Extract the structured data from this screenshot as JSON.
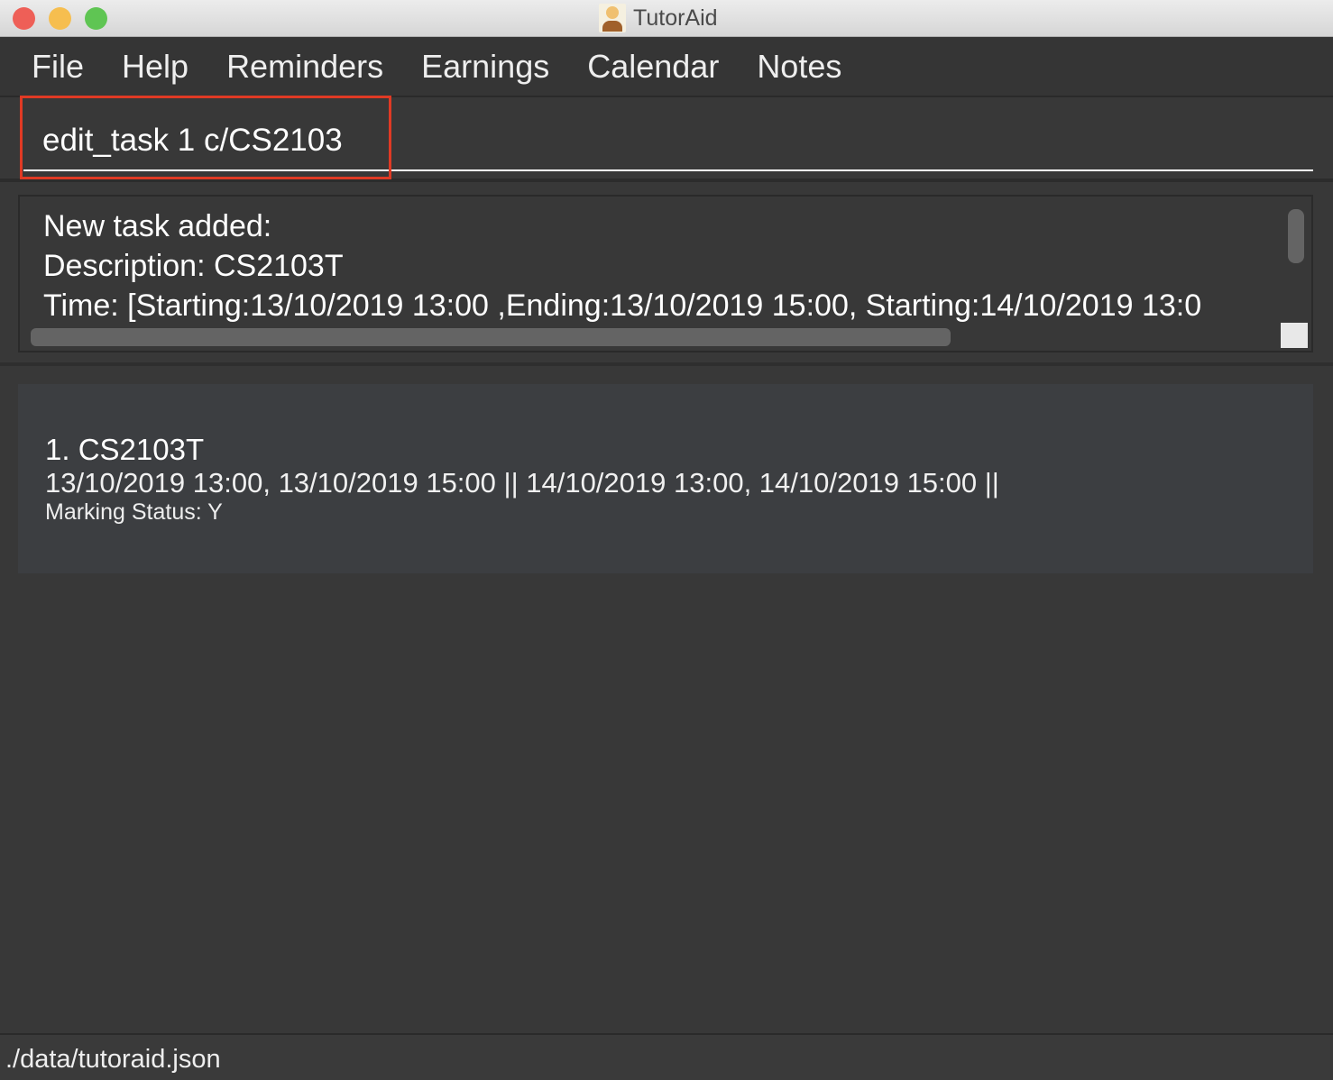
{
  "window": {
    "title": "TutorAid",
    "icon": "tutor-avatar-icon",
    "controls": {
      "close": "#ee5f57",
      "minimize": "#f6be4f",
      "maximize": "#5fc553"
    }
  },
  "menu": [
    "File",
    "Help",
    "Reminders",
    "Earnings",
    "Calendar",
    "Notes"
  ],
  "command": {
    "value": "edit_task 1 c/CS2103",
    "highlight_color": "#e03a24"
  },
  "result": {
    "lines": [
      "New task added:",
      " Description: CS2103T",
      "Time: [Starting:13/10/2019 13:00 ,Ending:13/10/2019 15:00, Starting:14/10/2019 13:0"
    ]
  },
  "tasks": [
    {
      "index": "1.  CS2103T",
      "times": "13/10/2019 13:00, 13/10/2019 15:00 || 14/10/2019 13:00, 14/10/2019 15:00 ||",
      "marking": "Marking Status: Y"
    }
  ],
  "status_bar": {
    "path": "./data/tutoraid.json"
  }
}
